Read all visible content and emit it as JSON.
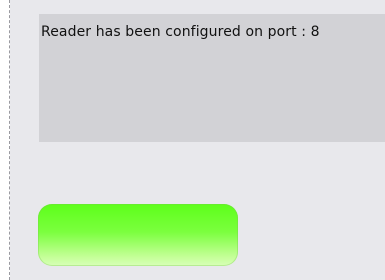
{
  "message": {
    "text": "Reader has been configured on port : 8"
  },
  "status_indicator": {
    "color": "#5dff1a",
    "label": ""
  }
}
